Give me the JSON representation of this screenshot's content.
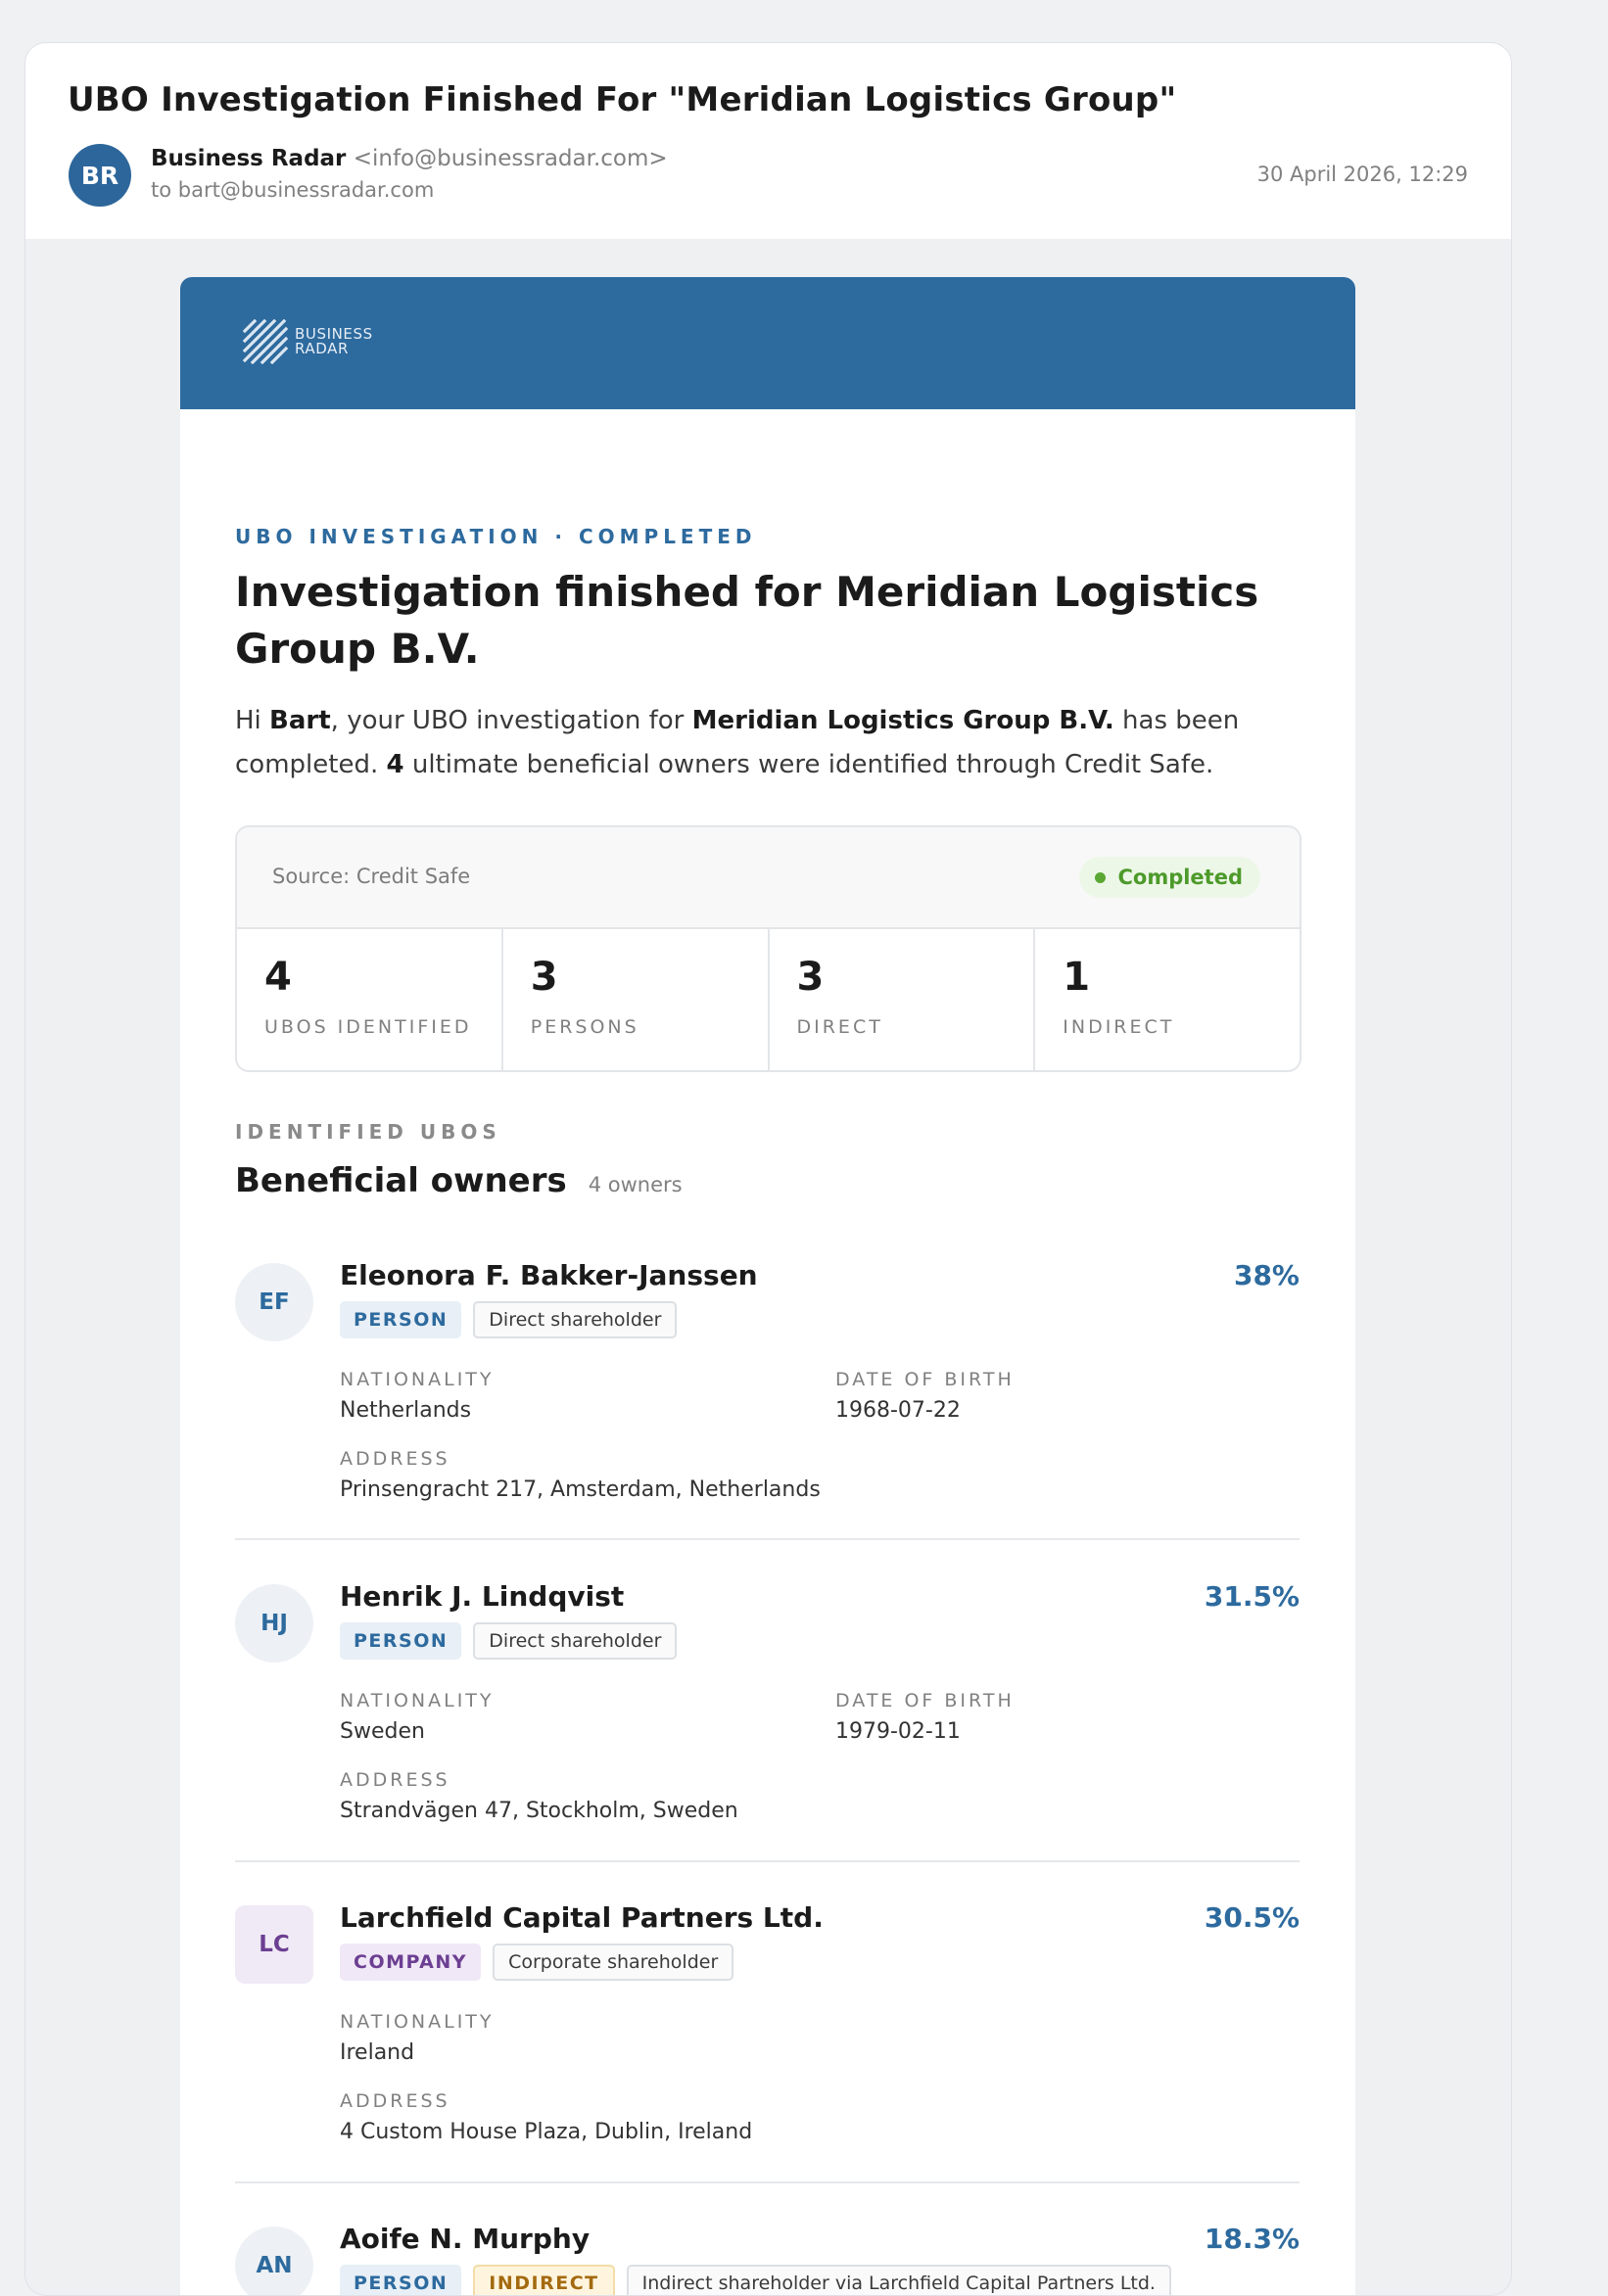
{
  "email": {
    "subject": "UBO Investigation Finished For \"Meridian Logistics Group\"",
    "sender_initials": "BR",
    "sender_name": "Business Radar",
    "sender_email": "<info@businessradar.com>",
    "recipient": "to bart@businessradar.com",
    "datetime": "30 April 2026, 12:29"
  },
  "brand": {
    "logo_line1": "BUSINESS",
    "logo_line2": "RADAR",
    "banner_color": "#2d6a9e"
  },
  "report": {
    "eyebrow": "UBO INVESTIGATION · COMPLETED",
    "headline": "Investigation finished for Meridian Logistics Group B.V.",
    "intro": {
      "greeting": "Hi ",
      "name": "Bart",
      "part1": ", your UBO investigation for ",
      "company": "Meridian Logistics Group B.V.",
      "part2": " has been completed. ",
      "count": "4",
      "part3": " ultimate beneficial owners were identified through Credit Safe."
    },
    "summary": {
      "source": "Source: Credit Safe",
      "status": "Completed",
      "stats": [
        {
          "value": "4",
          "label": "UBOS IDENTIFIED"
        },
        {
          "value": "3",
          "label": "PERSONS"
        },
        {
          "value": "3",
          "label": "DIRECT"
        },
        {
          "value": "1",
          "label": "INDIRECT"
        }
      ]
    },
    "owners_section": {
      "eyebrow": "IDENTIFIED UBOS",
      "title": "Beneficial owners",
      "count": "4 owners"
    },
    "labels": {
      "nationality": "NATIONALITY",
      "dob": "DATE OF BIRTH",
      "address": "ADDRESS"
    },
    "owners": [
      {
        "initials": "EF",
        "name": "Eleonora F. Bakker-Janssen",
        "percentage": "38%",
        "type": "PERSON",
        "role": "Direct shareholder",
        "nationality": "Netherlands",
        "dob": "1968-07-22",
        "address": "Prinsengracht 217, Amsterdam, Netherlands"
      },
      {
        "initials": "HJ",
        "name": "Henrik J. Lindqvist",
        "percentage": "31.5%",
        "type": "PERSON",
        "role": "Direct shareholder",
        "nationality": "Sweden",
        "dob": "1979-02-11",
        "address": "Strandvägen 47, Stockholm, Sweden"
      },
      {
        "initials": "LC",
        "name": "Larchfield Capital Partners Ltd.",
        "percentage": "30.5%",
        "type": "COMPANY",
        "role": "Corporate shareholder",
        "nationality": "Ireland",
        "address": "4 Custom House Plaza, Dublin, Ireland"
      },
      {
        "initials": "AN",
        "name": "Aoife N. Murphy",
        "percentage": "18.3%",
        "type": "PERSON",
        "indirect_tag": "INDIRECT",
        "role": "Indirect shareholder via Larchfield Capital Partners Ltd."
      }
    ]
  }
}
